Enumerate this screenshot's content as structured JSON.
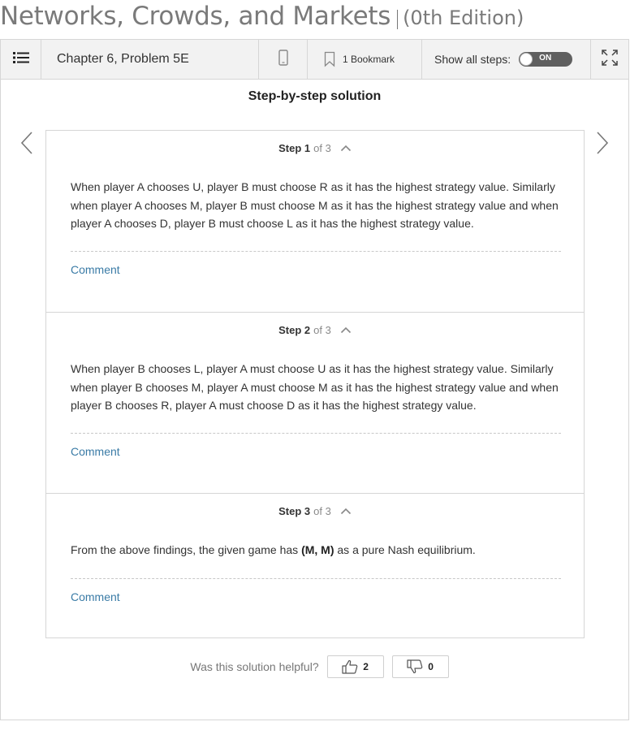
{
  "book": {
    "title": "Networks, Crowds, and Markets",
    "edition": "(0th Edition)"
  },
  "toolbar": {
    "chapter_label": "Chapter 6, Problem 5E",
    "bookmark_label": "1 Bookmark",
    "show_steps_label": "Show all steps:",
    "toggle_label": "ON",
    "icons": [
      "list-icon",
      "mobile-icon",
      "bookmark-icon",
      "expand-icon"
    ]
  },
  "solution": {
    "heading": "Step-by-step solution",
    "steps": [
      {
        "label": "Step 1",
        "of": "of 3",
        "text": "When player A chooses U, player B must choose R as it has the highest strategy value. Similarly when player A chooses M, player B must choose M as it has the highest strategy value and when player A chooses D, player B must choose L as it has the highest strategy value.",
        "comment": "Comment"
      },
      {
        "label": "Step 2",
        "of": "of 3",
        "text": "When player B chooses L, player A must choose U as it has the highest strategy value. Similarly when player B chooses M, player A must choose M as it has the highest strategy value and when player B chooses R, player A must choose D as it has the highest strategy value.",
        "comment": "Comment"
      },
      {
        "label": "Step 3",
        "of": "of 3",
        "text_before": "From the above findings, the given game has ",
        "text_bold": "(M, M)",
        "text_after": " as a pure Nash equilibrium.",
        "comment": "Comment"
      }
    ]
  },
  "feedback": {
    "question": "Was this solution helpful?",
    "likes": "2",
    "dislikes": "0"
  },
  "colors": {
    "link": "#3a7ba6",
    "toolbar_bg": "#f2f2f2",
    "toggle_bg": "#5f5f5f"
  }
}
